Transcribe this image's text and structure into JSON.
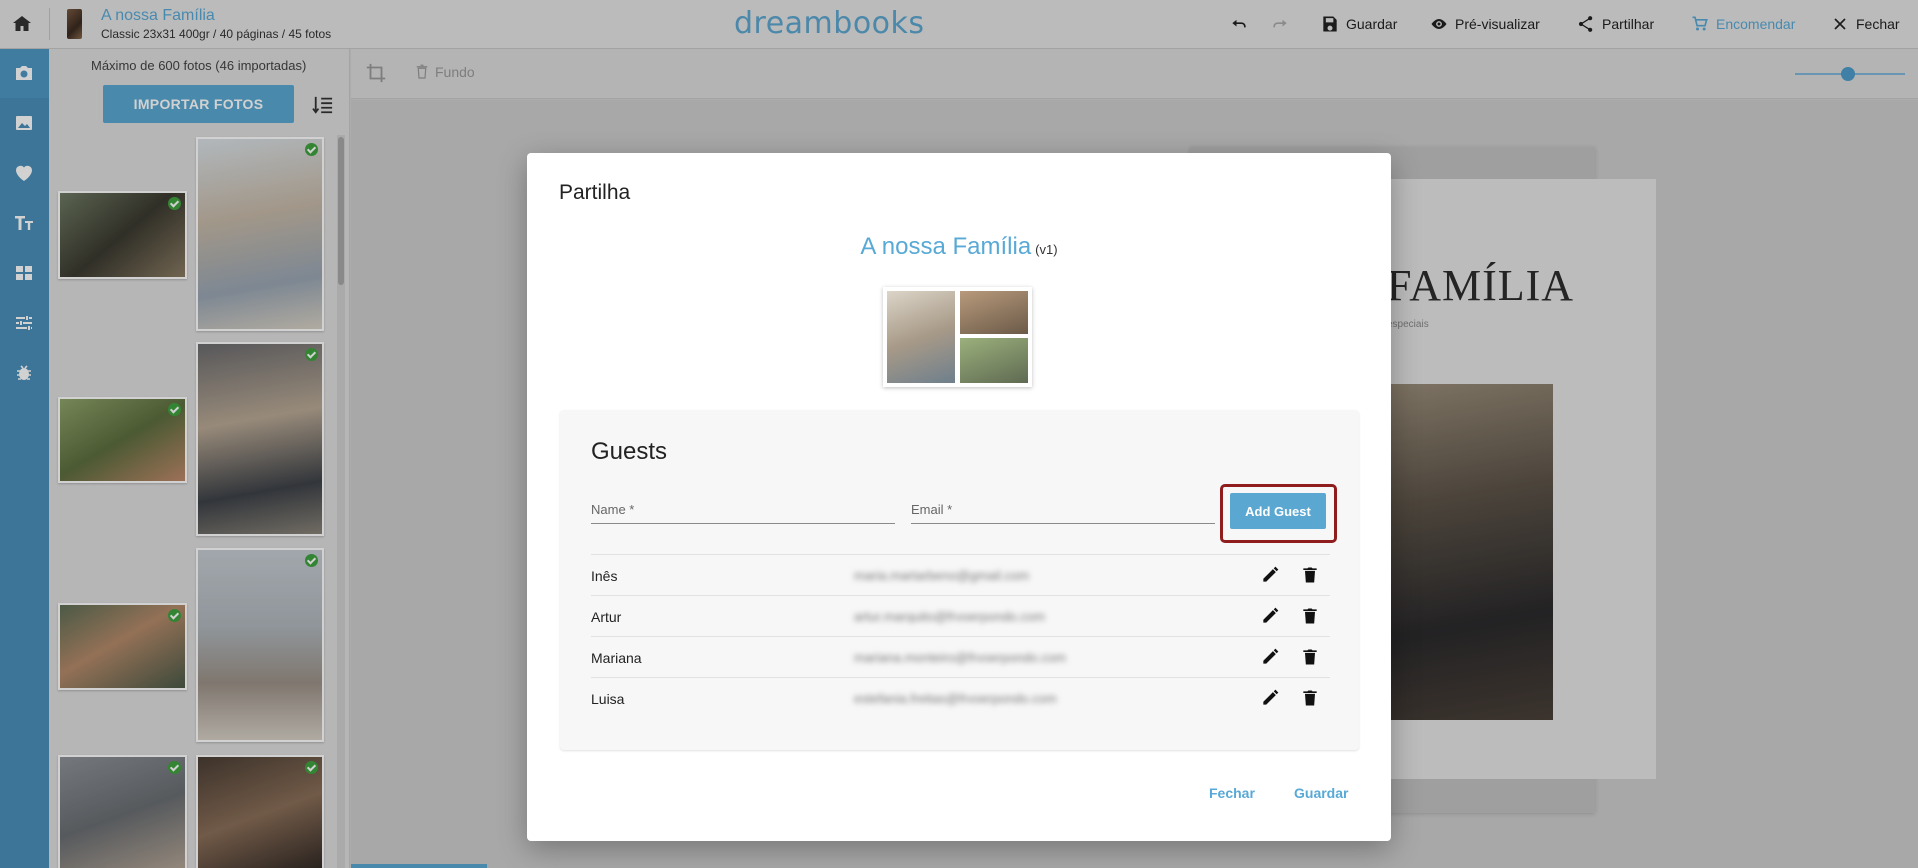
{
  "app": {
    "logo": "dreambooks"
  },
  "book": {
    "title": "A nossa Família",
    "subtitle": "Classic 23x31 400gr / 40 páginas / 45 fotos"
  },
  "toolbar": {
    "save_label": "Guardar",
    "preview_label": "Pré-visualizar",
    "share_label": "Partilhar",
    "order_label": "Encomendar",
    "close_label": "Fechar"
  },
  "photos": {
    "max_text": "Máximo de 600 fotos (46 importadas)",
    "import_label": "IMPORTAR FOTOS"
  },
  "editor": {
    "fundo_label": "Fundo",
    "page_title": "FAMÍLIA",
    "page_subtitle": "especiais"
  },
  "modal": {
    "title": "Partilha",
    "album_name": "A nossa Família",
    "album_version": "(v1)",
    "guests": {
      "title": "Guests",
      "name_placeholder": "Name *",
      "email_placeholder": "Email *",
      "add_label": "Add Guest",
      "rows": [
        {
          "name": "Inês",
          "email": "maria.martarbeno@gmail.com"
        },
        {
          "name": "Artur",
          "email": "artur.marquito@frvoerpondo.com"
        },
        {
          "name": "Mariana",
          "email": "mariana.monteiro@frvoerpondo.com"
        },
        {
          "name": "Luisa",
          "email": "estefania.freitas@frvoerpondo.com"
        }
      ]
    },
    "close_label": "Fechar",
    "save_label": "Guardar"
  },
  "colors": {
    "accent": "#58a9d6",
    "rail": "#4a8fb9",
    "highlight": "#8f1d1d",
    "check": "#3fa33f"
  }
}
